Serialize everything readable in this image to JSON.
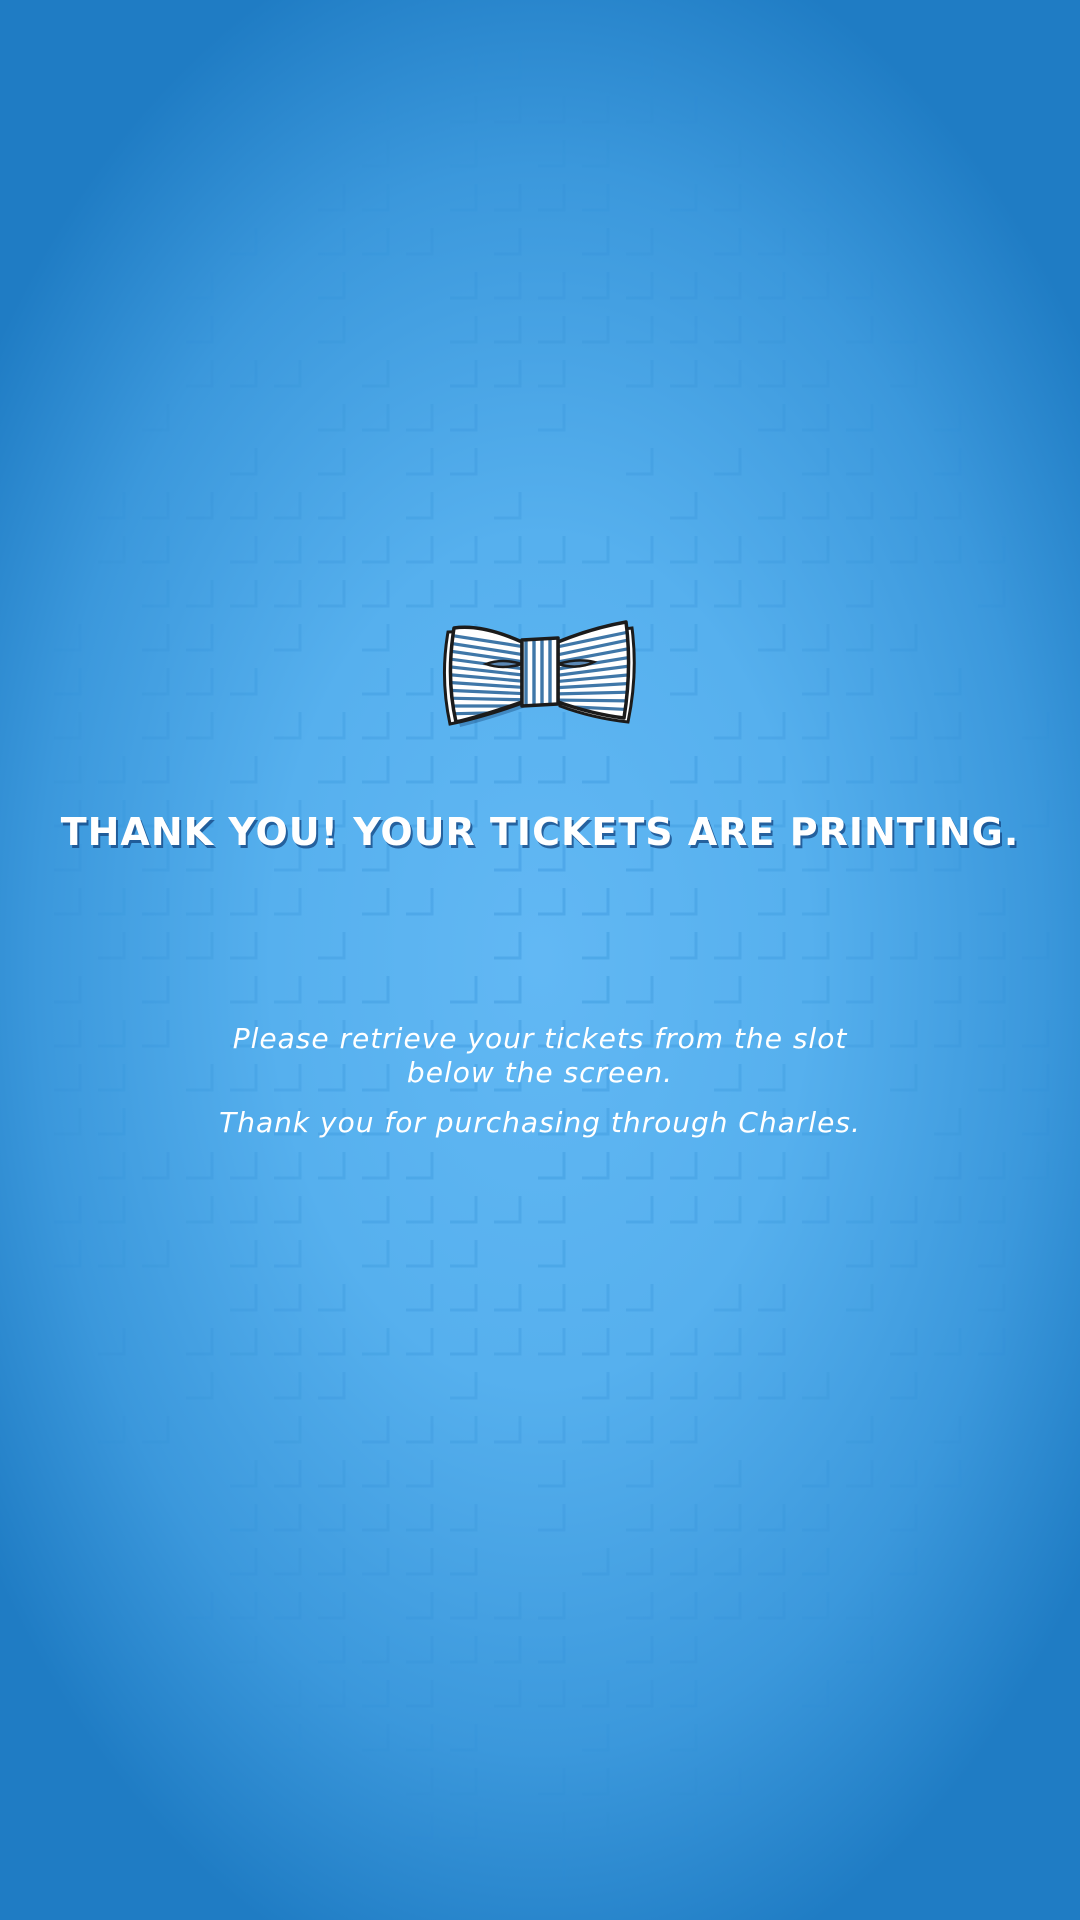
{
  "screen": {
    "headline": "THANK YOU! YOUR TICKETS ARE PRINTING.",
    "instruction_line_1": "Please retrieve your tickets from the slot",
    "instruction_line_2": "below the screen.",
    "thanks_message": "Thank you for purchasing through Charles."
  },
  "icons": {
    "logo": "bowtie-icon"
  },
  "colors": {
    "background_center": "#62b8f4",
    "background_edge": "#1f7cc4",
    "text": "#ffffff",
    "headline_shadow": "#14467f"
  }
}
